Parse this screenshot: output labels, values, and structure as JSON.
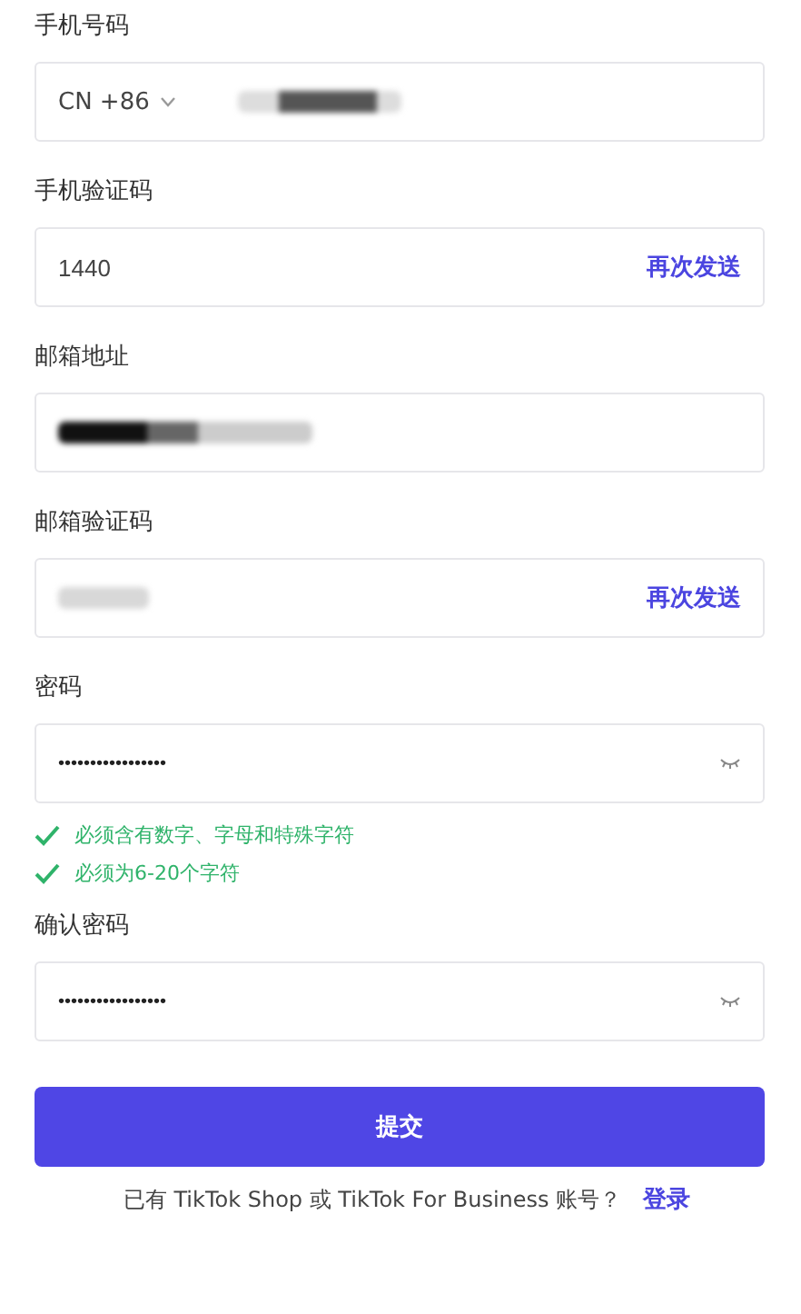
{
  "fields": [
    {
      "kind": "phone",
      "label": "手机号码",
      "prefix": "CN +86",
      "value_hidden": true
    },
    {
      "kind": "code",
      "label": "手机验证码",
      "value": "1440",
      "action": "再次发送"
    },
    {
      "kind": "text",
      "label": "邮箱地址",
      "value_hidden": true
    },
    {
      "kind": "code",
      "label": "邮箱验证码",
      "value_hidden": true,
      "action": "再次发送"
    },
    {
      "kind": "password",
      "label": "密码",
      "value": "•••••••••••••••••",
      "rules": [
        {
          "text": "必须含有数字、字母和特殊字符",
          "met": true
        },
        {
          "text": "必须为6-20个字符",
          "met": true
        }
      ]
    },
    {
      "kind": "password",
      "label": "确认密码",
      "value": "•••••••••••••••••"
    }
  ],
  "submit": "提交",
  "footer": {
    "text": "已有 TikTok Shop 或 TikTok For Business 账号？",
    "link": "登录"
  }
}
